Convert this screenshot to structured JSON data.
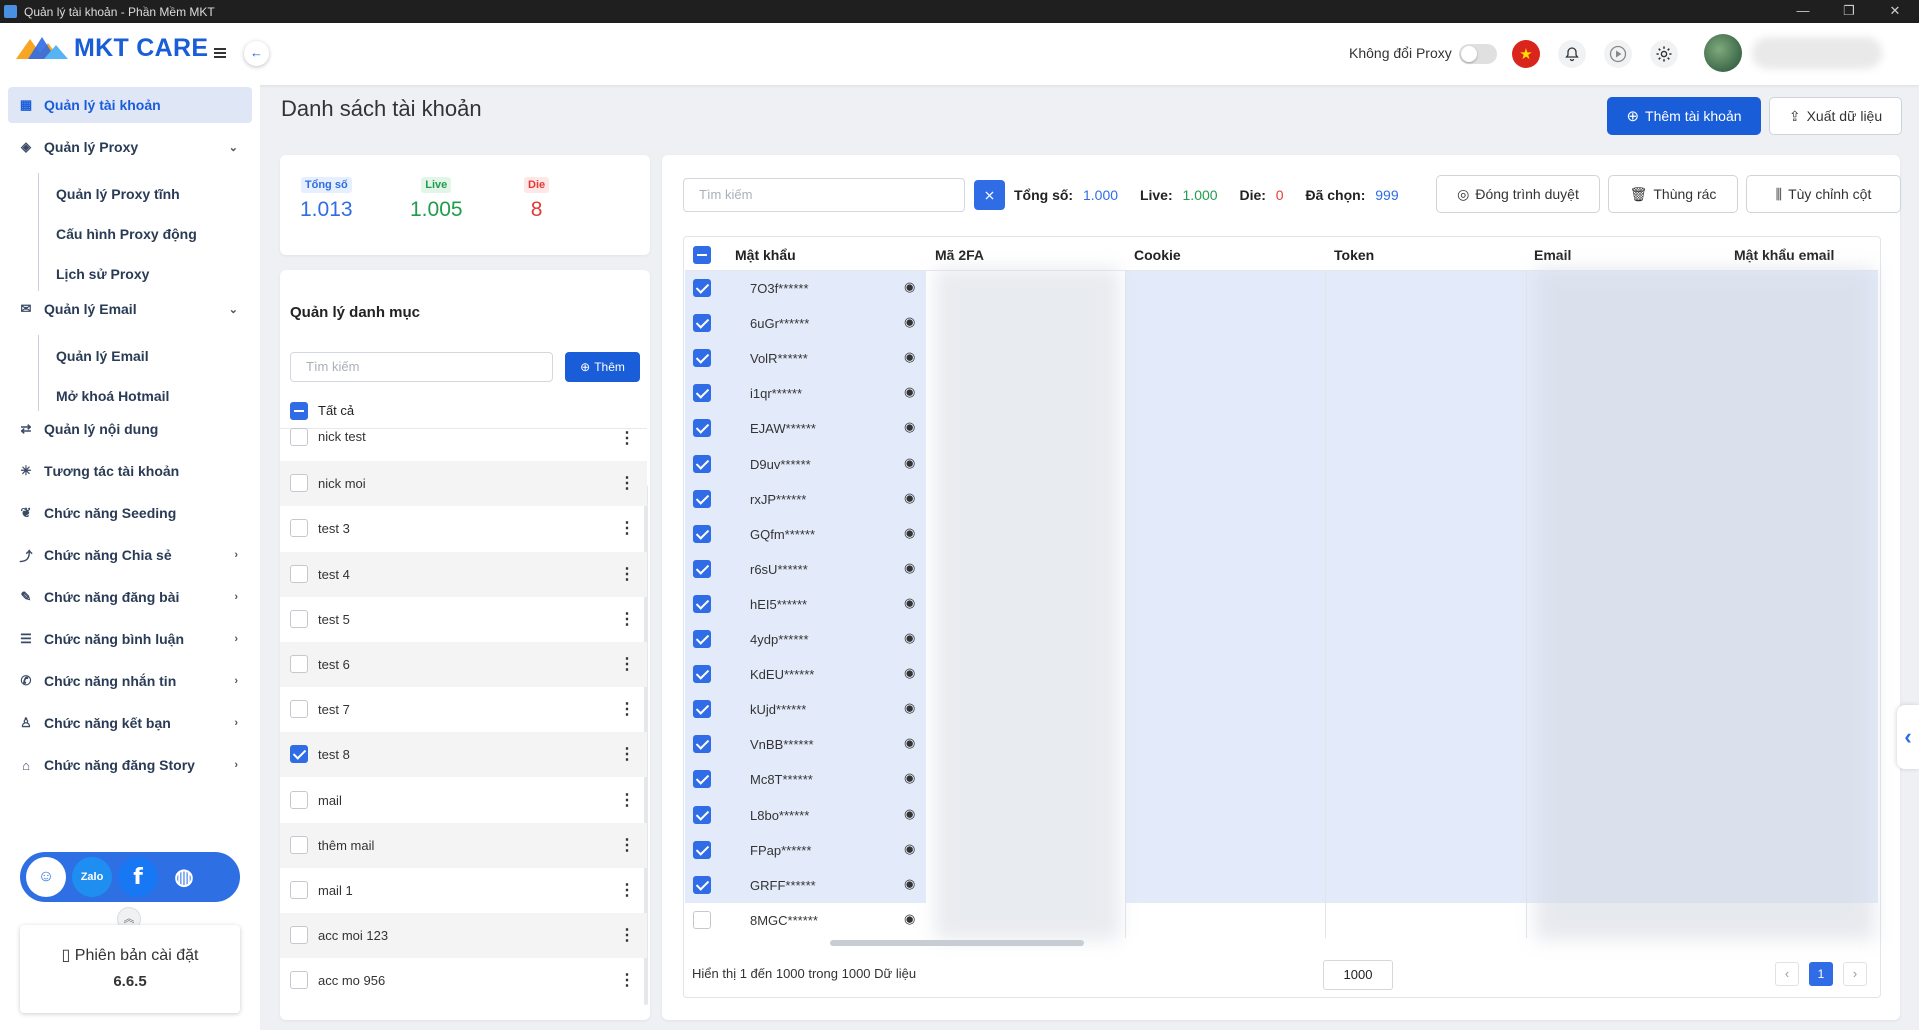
{
  "window": {
    "title": "Quản lý tài khoản - Phần Mềm MKT",
    "controls": [
      "—",
      "❐",
      "✕"
    ]
  },
  "header": {
    "logo_text": "MKT CARE",
    "proxy_label": "Không đổi Proxy"
  },
  "sidebar": {
    "items": [
      {
        "label": "Quản lý tài khoản",
        "icon": "grid-icon"
      },
      {
        "label": "Quản lý Proxy",
        "icon": "layers-icon"
      },
      {
        "label": "Quản lý Email",
        "icon": "mail-icon"
      },
      {
        "label": "Quản lý nội dung",
        "icon": "content-icon"
      },
      {
        "label": "Tương tác tài khoản",
        "icon": "interact-icon"
      },
      {
        "label": "Chức năng Seeding",
        "icon": "seeding-icon"
      },
      {
        "label": "Chức năng Chia sẻ",
        "icon": "share-icon"
      },
      {
        "label": "Chức năng đăng bài",
        "icon": "post-icon"
      },
      {
        "label": "Chức năng bình luận",
        "icon": "comment-icon"
      },
      {
        "label": "Chức năng nhắn tin",
        "icon": "message-icon"
      },
      {
        "label": "Chức năng kết bạn",
        "icon": "friend-icon"
      },
      {
        "label": "Chức năng đăng Story",
        "icon": "story-icon"
      }
    ],
    "proxy_sub": [
      "Quản lý Proxy tĩnh",
      "Cấu hình Proxy động",
      "Lịch sử Proxy"
    ],
    "email_sub": [
      "Quản lý Email",
      "Mở khoá Hotmail"
    ],
    "version_label": "Phiên bản cài đặt",
    "version": "6.6.5"
  },
  "main": {
    "title": "Danh sách tài khoản",
    "add_account": "Thêm tài khoản",
    "export": "Xuất dữ liệu"
  },
  "stats": {
    "total_label": "Tổng số",
    "total": "1.013",
    "live_label": "Live",
    "live": "1.005",
    "die_label": "Die",
    "die": "8"
  },
  "categories": {
    "title": "Quản lý danh mục",
    "search_placeholder": "Tìm kiếm",
    "add_label": "Thêm",
    "all_label": "Tất cả",
    "items": [
      {
        "label": "nick test",
        "checked": false
      },
      {
        "label": "nick moi",
        "checked": false
      },
      {
        "label": "test 3",
        "checked": false
      },
      {
        "label": "test 4",
        "checked": false
      },
      {
        "label": "test 5",
        "checked": false
      },
      {
        "label": "test 6",
        "checked": false
      },
      {
        "label": "test 7",
        "checked": false
      },
      {
        "label": "test 8",
        "checked": true
      },
      {
        "label": "mail",
        "checked": false
      },
      {
        "label": "thêm mail",
        "checked": false
      },
      {
        "label": "mail 1",
        "checked": false
      },
      {
        "label": "acc moi 123",
        "checked": false
      },
      {
        "label": "acc mo 956",
        "checked": false
      }
    ]
  },
  "toolbar": {
    "search_placeholder": "Tìm kiếm",
    "total_label": "Tổng số:",
    "total": "1.000",
    "live_label": "Live:",
    "live": "1.000",
    "die_label": "Die:",
    "die": "0",
    "selected_label": "Đã chọn:",
    "selected": "999",
    "close_browser": "Đóng trình duyệt",
    "trash": "Thùng rác",
    "customize_columns": "Tùy chỉnh cột"
  },
  "table": {
    "columns": [
      "Mật khẩu",
      "Mã 2FA",
      "Cookie",
      "Token",
      "Email",
      "Mật khẩu email"
    ],
    "rows": [
      {
        "password": "7O3f******",
        "checked": true
      },
      {
        "password": "6uGr******",
        "checked": true
      },
      {
        "password": "VolR******",
        "checked": true
      },
      {
        "password": "i1qr******",
        "checked": true
      },
      {
        "password": "EJAW******",
        "checked": true
      },
      {
        "password": "D9uv******",
        "checked": true
      },
      {
        "password": "rxJP******",
        "checked": true
      },
      {
        "password": "GQfm******",
        "checked": true
      },
      {
        "password": "r6sU******",
        "checked": true
      },
      {
        "password": "hEI5******",
        "checked": true
      },
      {
        "password": "4ydp******",
        "checked": true
      },
      {
        "password": "KdEU******",
        "checked": true
      },
      {
        "password": "kUjd******",
        "checked": true
      },
      {
        "password": "VnBB******",
        "checked": true
      },
      {
        "password": "Mc8T******",
        "checked": true
      },
      {
        "password": "L8bo******",
        "checked": true
      },
      {
        "password": "FPap******",
        "checked": true
      },
      {
        "password": "GRFF******",
        "checked": true
      },
      {
        "password": "8MGC******",
        "checked": false
      }
    ]
  },
  "footer": {
    "showing": "Hiển thị 1 đến 1000 trong 1000 Dữ liệu",
    "page_size": "1000",
    "current_page": "1",
    "prev": "‹",
    "next": "›"
  },
  "colors": {
    "primary": "#1a5dd8",
    "live": "#1f9d4c",
    "die": "#e53935",
    "selected_row": "#e3ebfb"
  }
}
